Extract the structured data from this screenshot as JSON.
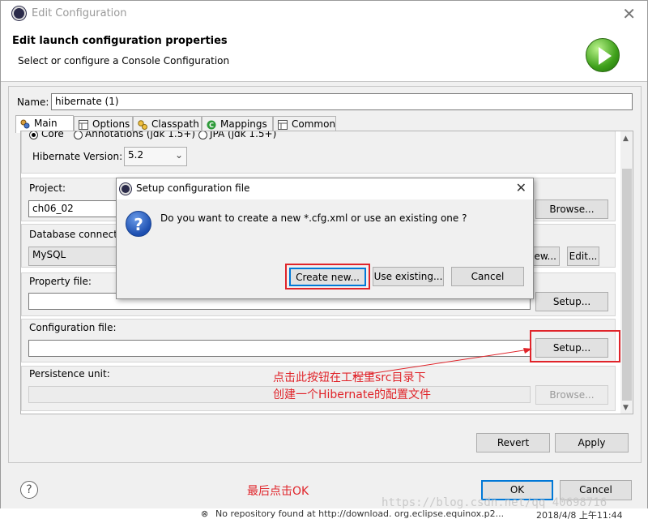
{
  "window": {
    "title": "Edit Configuration",
    "close_glyph": "✕"
  },
  "header": {
    "heading": "Edit launch configuration properties",
    "subheading": "Select or configure a Console Configuration",
    "icon": "run-icon"
  },
  "name_field": {
    "label": "Name:",
    "value": "hibernate (1)"
  },
  "tabs": [
    {
      "label": "Main",
      "icon": "main-tab-icon",
      "active": true
    },
    {
      "label": "Options",
      "icon": "options-tab-icon"
    },
    {
      "label": "Classpath",
      "icon": "classpath-tab-icon"
    },
    {
      "label": "Mappings",
      "icon": "mappings-tab-icon"
    },
    {
      "label": "Common",
      "icon": "common-tab-icon"
    }
  ],
  "main": {
    "type_options": {
      "core": "Core",
      "annotations": "Annotations (jdk 1.5+)",
      "jpa": "JPA (jdk 1.5+)",
      "selected": "Core"
    },
    "hibernate_version": {
      "label": "Hibernate Version:",
      "value": "5.2"
    },
    "project": {
      "label": "Project:",
      "value": "ch06_02",
      "browse_label": "Browse..."
    },
    "database_connection": {
      "label": "Database connecti",
      "value": "MySQL",
      "new_label": "New...",
      "new_visible_label": "lew...",
      "edit_label": "Edit..."
    },
    "property_file": {
      "label": "Property file:",
      "value": "",
      "setup_label": "Setup..."
    },
    "configuration_file": {
      "label": "Configuration file:",
      "value": "",
      "setup_label": "Setup..."
    },
    "persistence_unit": {
      "label": "Persistence unit:",
      "value": "",
      "browse_label": "Browse..."
    }
  },
  "actions": {
    "revert_label": "Revert",
    "apply_label": "Apply",
    "ok_label": "OK",
    "cancel_label": "Cancel",
    "help_glyph": "?"
  },
  "dialog": {
    "title": "Setup configuration file",
    "close_glyph": "✕",
    "message": "Do you want to create a new *.cfg.xml or use an existing one ?",
    "icon": "question-icon",
    "icon_glyph": "?",
    "create_new_label": "Create new...",
    "use_existing_label": "Use existing...",
    "cancel_label": "Cancel"
  },
  "annotations": {
    "setup_note_line1": "点击此按钮在工程里src目录下",
    "setup_note_line2": "创建一个Hibernate的配置文件",
    "ok_note": "最后点击OK",
    "color": "#e0242a"
  },
  "watermark": "https://blog.csdn.net/qq_40698716",
  "status_bar": {
    "message": "No repository found at http://download. org.eclipse.equinox.p2...",
    "timestamp": "2018/4/8 上午11:44"
  }
}
